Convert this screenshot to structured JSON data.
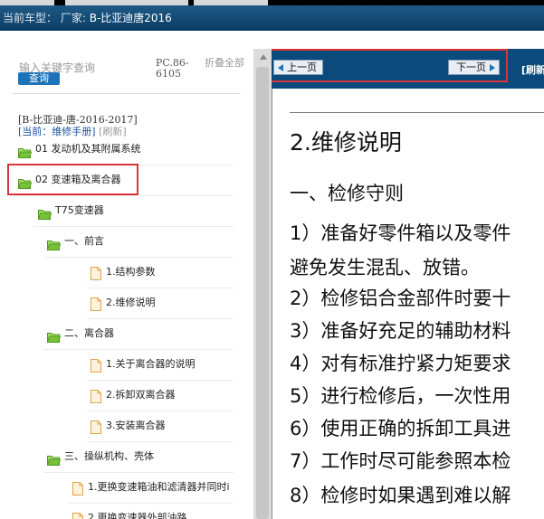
{
  "header": {
    "current_model_label": "当前车型：",
    "maker_label": "厂家:",
    "model_value": "B-比亚迪唐2016"
  },
  "search": {
    "placeholder": "输入关键字查询",
    "button": "查询",
    "pc_code": "PC.86-6105",
    "collapse_all": "折叠全部"
  },
  "vehicle_path": "[B-比亚迪-唐-2016-2017]",
  "current": {
    "prefix": "[当前：",
    "value": "维修手册]",
    "refresh": "[刷新]"
  },
  "tree": [
    {
      "label": "01 发动机及其附属系统",
      "type": "folder"
    },
    {
      "label": "02 变速箱及离合器",
      "type": "folder"
    },
    {
      "label": "T75变速器",
      "type": "folder"
    },
    {
      "label": "一、前言",
      "type": "folder"
    },
    {
      "label": "1.结构参数",
      "type": "doc"
    },
    {
      "label": "2.维修说明",
      "type": "doc"
    },
    {
      "label": "二、离合器",
      "type": "folder"
    },
    {
      "label": "1.关于离合器的说明",
      "type": "doc"
    },
    {
      "label": "2.拆卸双离合器",
      "type": "doc"
    },
    {
      "label": "3.安装离合器",
      "type": "doc"
    },
    {
      "label": "三、操纵机构、壳体",
      "type": "folder"
    },
    {
      "label": "1.更换变速箱油和滤清器并同时i",
      "type": "doc"
    },
    {
      "label": "2.更换变速器外部油路",
      "type": "doc"
    }
  ],
  "nav": {
    "prev": "上一页",
    "next": "下一页",
    "refresh": "[刷新"
  },
  "document": {
    "title": "2.维修说明",
    "lines": [
      "一、检修守则",
      "1）准备好零件箱以及零件",
      "避免发生混乱、放错。",
      "2）检修铝合金部件时要十",
      "3）准备好充足的辅助材料",
      "4）对有标准拧紧力矩要求",
      "5）进行检修后，一次性用",
      "6）使用正确的拆卸工具进",
      "7）工作时尽可能参照本检",
      "8）检修时如果遇到难以解"
    ]
  },
  "colors": {
    "nav_bar": "#0b4a7a",
    "highlight": "#d9343a",
    "folder": "#78c23a",
    "doc": "#f2b85c"
  }
}
